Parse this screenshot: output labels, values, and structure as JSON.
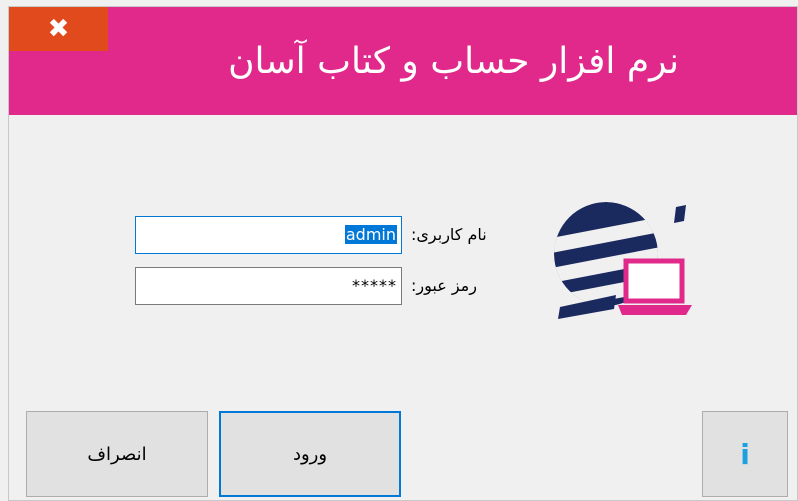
{
  "window": {
    "title": "نرم افزار حساب و کتاب آسان",
    "close_glyph": "✖"
  },
  "colors": {
    "titlebar": "#e0298a",
    "close_button": "#e04a1c",
    "logo_dark": "#1b2a5e",
    "logo_accent": "#e0298a",
    "focus": "#0078d7",
    "info": "#1ca0e0"
  },
  "form": {
    "username_label": "نام کاربری:",
    "username_value": "admin",
    "password_label": "رمز عبور:",
    "password_value": "*****"
  },
  "buttons": {
    "login_label": "ورود",
    "cancel_label": "انصراف",
    "info_glyph": "i"
  },
  "icons": {
    "logo": "app-logo-globe-laptop",
    "info": "info-icon",
    "close": "close-icon"
  }
}
